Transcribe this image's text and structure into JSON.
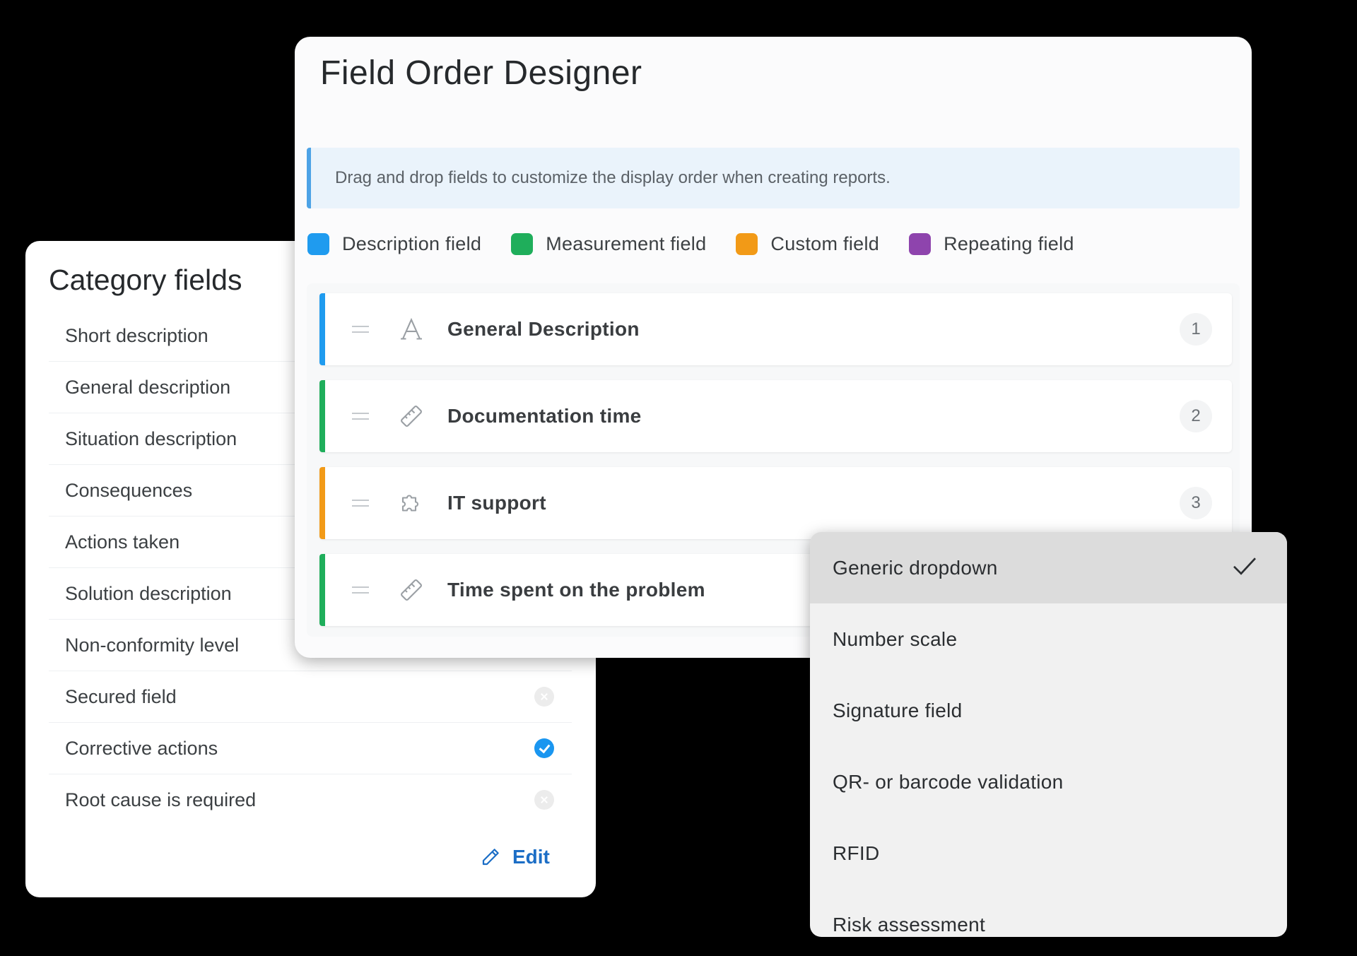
{
  "category_card": {
    "title": "Category fields",
    "fields": [
      {
        "label": "Short description",
        "state": "hidden"
      },
      {
        "label": "General description",
        "state": "hidden"
      },
      {
        "label": "Situation description",
        "state": "hidden"
      },
      {
        "label": "Consequences",
        "state": "hidden"
      },
      {
        "label": "Actions taken",
        "state": "hidden"
      },
      {
        "label": "Solution description",
        "state": "hidden"
      },
      {
        "label": "Non-conformity level",
        "state": "hidden"
      },
      {
        "label": "Secured field",
        "state": "off"
      },
      {
        "label": "Corrective actions",
        "state": "on"
      },
      {
        "label": "Root cause is required",
        "state": "off"
      }
    ],
    "edit_label": "Edit",
    "edit_icon": "pencil-icon"
  },
  "designer": {
    "title": "Field Order Designer",
    "info": "Drag and drop fields to customize the display order when creating reports.",
    "legend": [
      {
        "label": "Description field",
        "color": "#1f9bef"
      },
      {
        "label": "Measurement field",
        "color": "#1fae5b"
      },
      {
        "label": "Custom field",
        "color": "#f29a17"
      },
      {
        "label": "Repeating field",
        "color": "#8e44ad"
      }
    ],
    "rows": [
      {
        "name": "General Description",
        "order": "1",
        "icon": "text-icon",
        "color": "#1f9bef"
      },
      {
        "name": "Documentation time",
        "order": "2",
        "icon": "ruler-icon",
        "color": "#1fae5b"
      },
      {
        "name": "IT support",
        "order": "3",
        "icon": "puzzle-icon",
        "color": "#f29a17"
      },
      {
        "name": "Time spent on the problem",
        "order": "",
        "icon": "ruler-icon",
        "color": "#1fae5b"
      }
    ]
  },
  "dropdown": {
    "options": [
      {
        "label": "Generic dropdown",
        "selected": true
      },
      {
        "label": "Number scale",
        "selected": false
      },
      {
        "label": "Signature field",
        "selected": false
      },
      {
        "label": "QR- or barcode validation",
        "selected": false
      },
      {
        "label": "RFID",
        "selected": false
      },
      {
        "label": "Risk assessment",
        "selected": false
      }
    ]
  }
}
